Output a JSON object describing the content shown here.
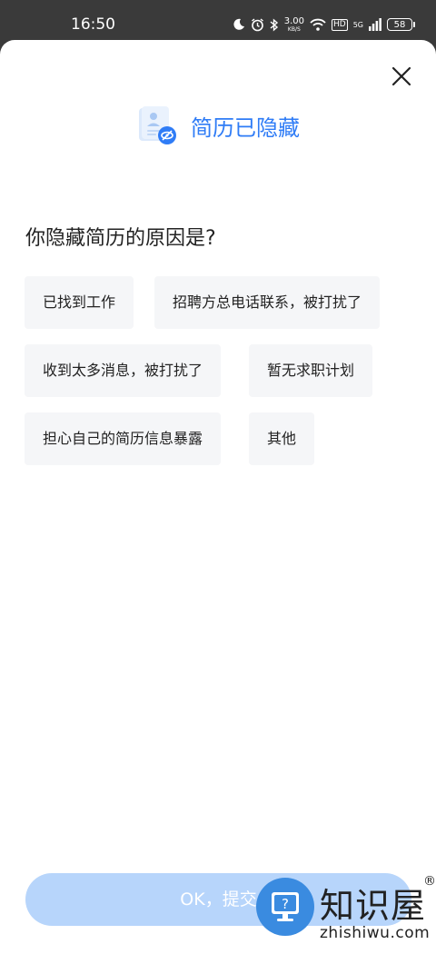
{
  "status_bar": {
    "time": "16:50",
    "speed_value": "3.00",
    "speed_unit": "KB/S",
    "hd_label": "HD",
    "network_label": "5G",
    "battery": "58"
  },
  "header": {
    "title": "简历已隐藏",
    "icon": "resume-hidden-icon",
    "title_color": "#2f7cf6"
  },
  "question": "你隐藏简历的原因是?",
  "reasons": [
    "已找到工作",
    "招聘方总电话联系，被打扰了",
    "收到太多消息，被打扰了",
    "暂无求职计划",
    "担心自己的简历信息暴露",
    "其他"
  ],
  "submit_label": "OK，提交",
  "submit_color": "#b7d5fb",
  "watermark": {
    "name": "知识屋",
    "url": "zhishiwu.com",
    "registered": "®"
  }
}
